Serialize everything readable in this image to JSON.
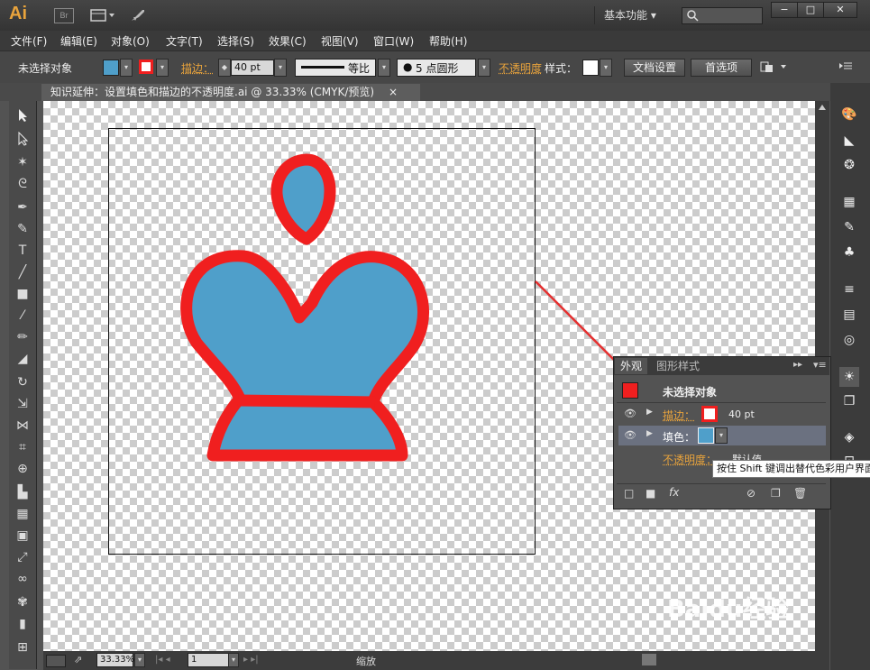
{
  "app": {
    "logo": "Ai",
    "bridge": "Br",
    "workspace": "基本功能",
    "window_buttons": [
      "−",
      "□",
      "✕"
    ]
  },
  "menu": [
    "文件(F)",
    "编辑(E)",
    "对象(O)",
    "文字(T)",
    "选择(S)",
    "效果(C)",
    "视图(V)",
    "窗口(W)",
    "帮助(H)"
  ],
  "control": {
    "selection": "未选择对象",
    "stroke_label": "描边：",
    "stroke_weight": "40 pt",
    "profile": "等比",
    "brush": "5 点圆形",
    "opacity_label": "不透明度",
    "style_label": "样式：",
    "doc_setup": "文档设置",
    "preferences": "首选项"
  },
  "document": {
    "tab_title": "知识延伸：设置填色和描边的不透明度.ai @ 33.33% (CMYK/预览)"
  },
  "appearance": {
    "tabs": [
      "外观",
      "图形样式"
    ],
    "header": "未选择对象",
    "stroke_label": "描边：",
    "stroke_value": "40 pt",
    "fill_label": "填色：",
    "opacity_label": "不透明度：",
    "opacity_value": "默认值",
    "fx": "fx"
  },
  "tooltip": "按住 Shift 键调出替代色彩用户界面",
  "status": {
    "zoom": "33.33%",
    "page": "1",
    "tool": "缩放"
  },
  "watermark": "Baidu经验",
  "colors": {
    "fill": "#4f9fca",
    "stroke": "#f01f1f",
    "accent": "#e8a33c"
  }
}
